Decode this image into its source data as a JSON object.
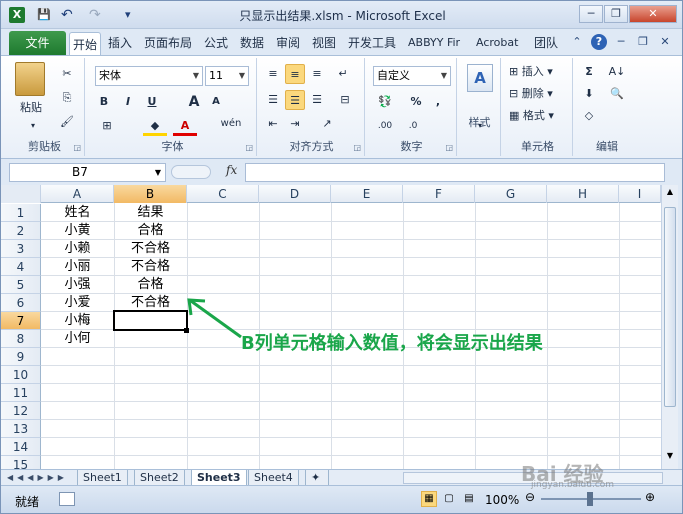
{
  "window": {
    "title": "只显示出结果.xlsm - Microsoft Excel",
    "minimize": "─",
    "restore": "❐",
    "close": "✕"
  },
  "quick_access": {
    "save": "💾",
    "undo": "↶",
    "redo": "↷",
    "dropdown": "▾"
  },
  "tabs": {
    "file": "文件",
    "items": [
      "开始",
      "插入",
      "页面布局",
      "公式",
      "数据",
      "审阅",
      "视图",
      "开发工具",
      "ABBYY Fir",
      "Acrobat",
      "团队"
    ],
    "active": "开始"
  },
  "ribbon": {
    "clipboard": {
      "label": "剪贴板",
      "paste": "粘贴"
    },
    "font": {
      "label": "字体",
      "name": "宋体",
      "size": "11",
      "bold": "B",
      "italic": "I",
      "underline": "U",
      "grow": "A",
      "shrink": "A",
      "wen": "wén"
    },
    "alignment": {
      "label": "对齐方式"
    },
    "number": {
      "label": "数字",
      "format": "自定义",
      "percent": "%",
      "comma": ","
    },
    "styles": {
      "label": "样式"
    },
    "cells": {
      "label": "单元格",
      "insert": "插入",
      "delete": "删除",
      "format": "格式"
    },
    "editing": {
      "label": "编辑",
      "sum": "Σ"
    }
  },
  "formula_bar": {
    "name_box": "B7",
    "fx": "fx",
    "value": ""
  },
  "columns": [
    "A",
    "B",
    "C",
    "D",
    "E",
    "F",
    "G",
    "H",
    "I"
  ],
  "rows": [
    "1",
    "2",
    "3",
    "4",
    "5",
    "6",
    "7",
    "8",
    "9",
    "10",
    "11",
    "12",
    "13",
    "14",
    "15"
  ],
  "cells": [
    {
      "row": "1",
      "a": "姓名",
      "b": "结果"
    },
    {
      "row": "2",
      "a": "小黄",
      "b": "合格"
    },
    {
      "row": "3",
      "a": "小赖",
      "b": "不合格"
    },
    {
      "row": "4",
      "a": "小丽",
      "b": "不合格"
    },
    {
      "row": "5",
      "a": "小强",
      "b": "合格"
    },
    {
      "row": "6",
      "a": "小爱",
      "b": "不合格"
    },
    {
      "row": "7",
      "a": "小梅",
      "b": ""
    },
    {
      "row": "8",
      "a": "小何",
      "b": ""
    }
  ],
  "selected_cell": "B7",
  "annotation": "B列单元格输入数值，将会显示出结果",
  "sheets": [
    "Sheet1",
    "Sheet2",
    "Sheet3",
    "Sheet4"
  ],
  "active_sheet": "Sheet3",
  "status": {
    "ready": "就绪",
    "zoom": "100%",
    "watermark": "Bai 经验",
    "watermark_url": "jingyan.baidu.com"
  },
  "colors": {
    "accent_green": "#1aa64a",
    "file_tab": "#2a8a3a",
    "selection": "#f2b964"
  }
}
